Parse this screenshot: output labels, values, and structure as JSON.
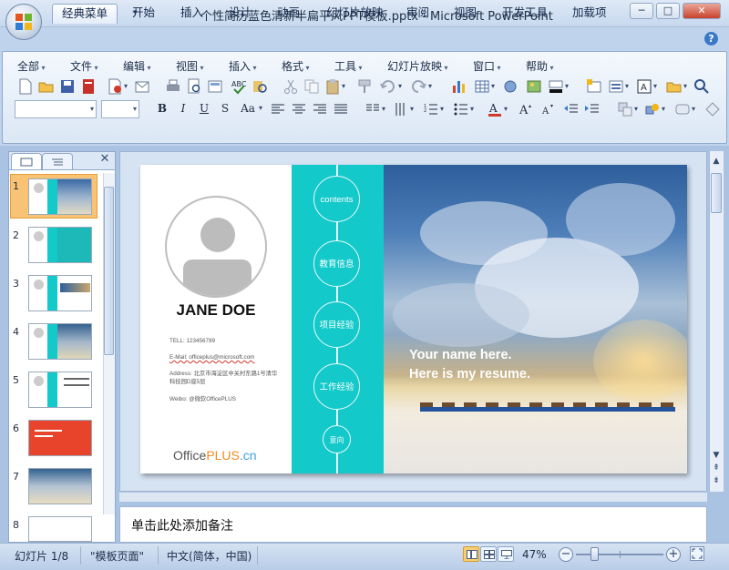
{
  "window": {
    "title": "个性简历蓝色清新半扁平风PPT模板.pptx - Microsoft PowerPoint",
    "buttons": {
      "minimize": "─",
      "maximize": "□",
      "close": "✕"
    }
  },
  "ribbon_tabs": [
    "经典菜单",
    "开始",
    "插入",
    "设计",
    "动画",
    "幻灯片放映",
    "审阅",
    "视图",
    "开发工具",
    "加载项"
  ],
  "active_tab": "经典菜单",
  "help_icon": "?",
  "classic_menu": [
    "全部",
    "文件",
    "编辑",
    "视图",
    "插入",
    "格式",
    "工具",
    "幻灯片放映",
    "窗口",
    "帮助"
  ],
  "format_buttons": {
    "bold": "B",
    "italic": "I",
    "underline": "U",
    "shadow": "S",
    "case": "Aa"
  },
  "slide_panel": {
    "close_icon": "✕",
    "numbers": [
      "1",
      "2",
      "3",
      "4",
      "5",
      "6",
      "7",
      "8"
    ],
    "selected": "1"
  },
  "slide": {
    "name": "JANE DOE",
    "tel": "TELL: 123456789",
    "email": "E-Mail: officeplus@microsoft.com",
    "address": "Address: 北京市海淀区中关村东路1号清华科技园D座5层",
    "weibo": "Weibo: @微软OfficePLUS",
    "brand_prefix": "Office",
    "brand_plus": "PLUS",
    "brand_suffix": ".cn",
    "nav_circles": [
      "contents",
      "教育信息",
      "项目经验",
      "工作经验",
      "意向"
    ],
    "headline_1": "Your name here.",
    "headline_2": "Here is my resume."
  },
  "notes_placeholder": "单击此处添加备注",
  "status": {
    "slide_info": "幻灯片 1/8",
    "theme": "\"模板页面\"",
    "language": "中文(简体，中国)",
    "zoom": "47%",
    "zoom_out": "−",
    "zoom_in": "+"
  },
  "colors": {
    "teal": "#14c9ca",
    "accent_orange": "#f28a1e",
    "ribbon_blue": "#bfd4ec"
  }
}
